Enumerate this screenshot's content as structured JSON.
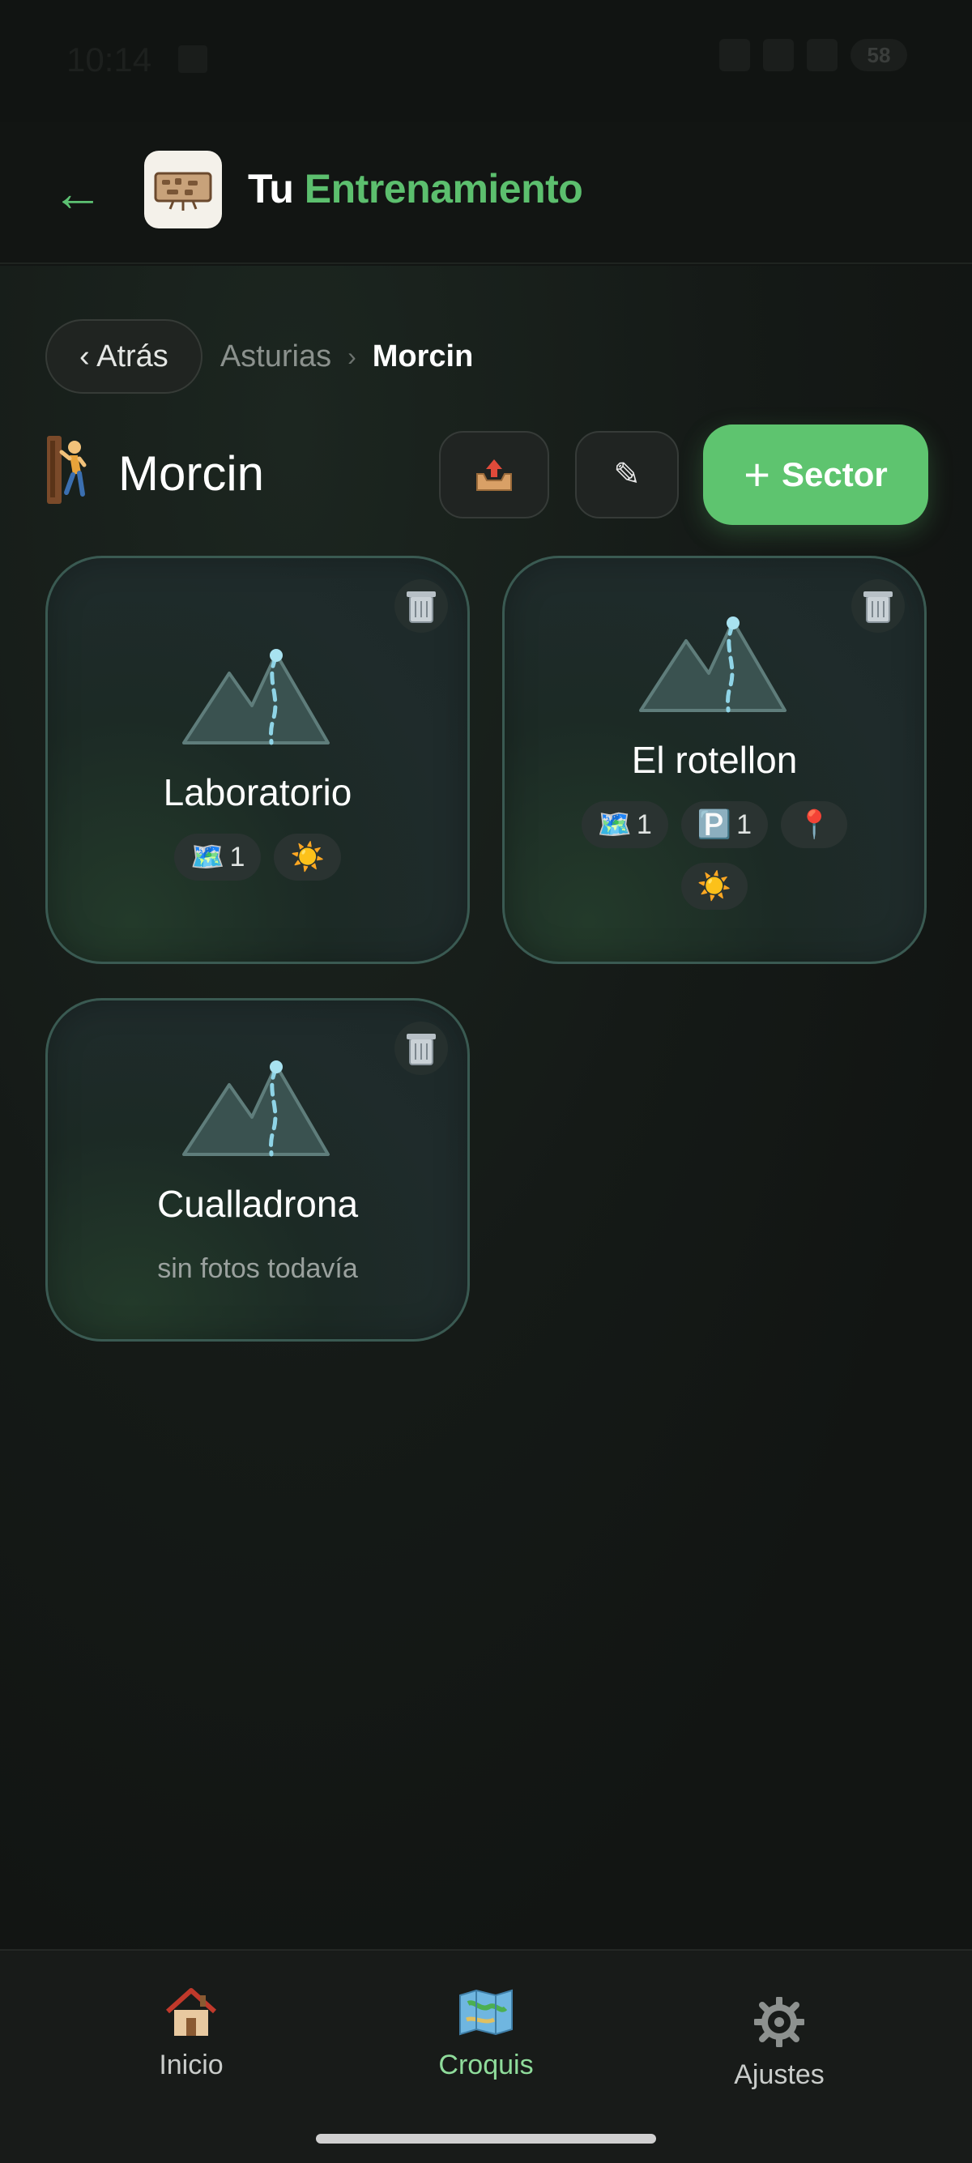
{
  "status_bar": {
    "time": "10:14",
    "battery": "58"
  },
  "header": {
    "title_part1": "Tu",
    "title_part2": "Entrenamiento"
  },
  "breadcrumb": {
    "back_label": "‹ Atrás",
    "region": "Asturias",
    "separator": "›",
    "current": "Morcin"
  },
  "page": {
    "title": "Morcin",
    "add_sector_label": "Sector",
    "edit_glyph": "✎"
  },
  "sectors": [
    {
      "name": "Laboratorio",
      "badges": [
        {
          "icon": "map-icon",
          "count": "1"
        },
        {
          "icon": "sun-icon",
          "count": ""
        }
      ]
    },
    {
      "name": "El rotellon",
      "badges": [
        {
          "icon": "map-icon",
          "count": "1"
        },
        {
          "icon": "parking-icon",
          "count": "1"
        },
        {
          "icon": "pin-icon",
          "count": ""
        },
        {
          "icon": "sun-icon",
          "count": ""
        }
      ]
    },
    {
      "name": "Cualladrona",
      "empty_text": "sin fotos todavía"
    }
  ],
  "nav": [
    {
      "label": "Inicio",
      "icon": "home-icon",
      "active": false
    },
    {
      "label": "Croquis",
      "icon": "map-icon",
      "active": true
    },
    {
      "label": "Ajustes",
      "icon": "gear-icon",
      "active": false
    }
  ],
  "colors": {
    "accent": "#5ec46f",
    "background": "#121513",
    "card_border": "#3a5a52",
    "nav_active": "#8fdc9b"
  }
}
